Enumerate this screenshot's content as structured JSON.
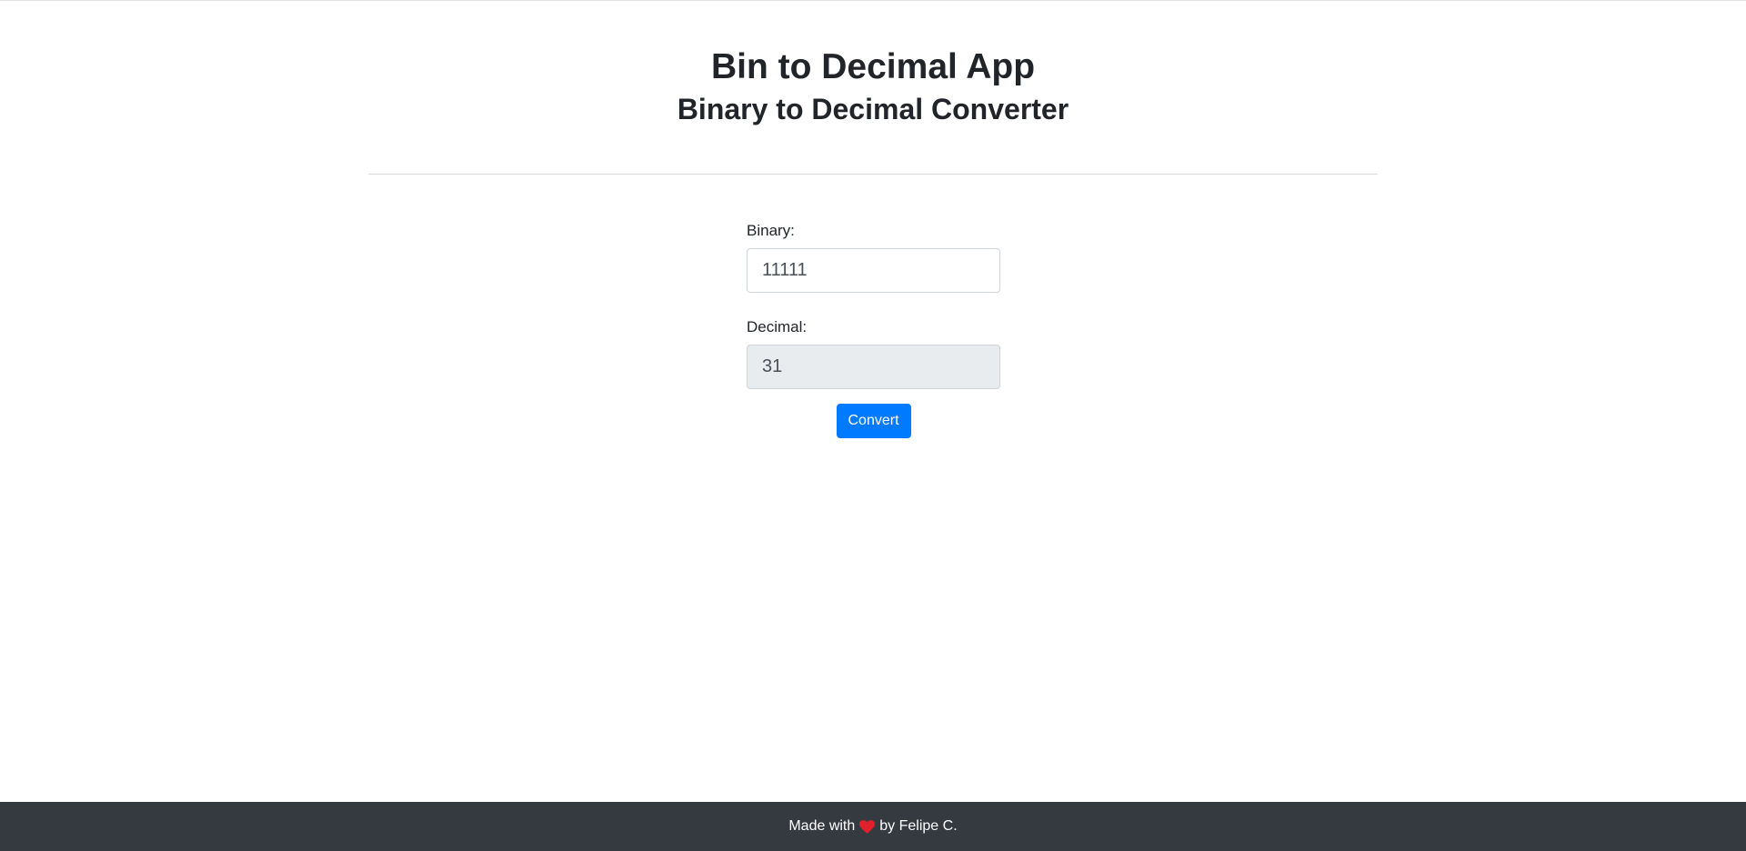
{
  "header": {
    "title": "Bin to Decimal App",
    "subtitle": "Binary to Decimal Converter"
  },
  "form": {
    "binary_label": "Binary:",
    "binary_value": "11111",
    "decimal_label": "Decimal:",
    "decimal_value": "31",
    "convert_label": "Convert"
  },
  "footer": {
    "text_before": "Made with",
    "icon": "heart-icon",
    "text_after": "by Felipe C."
  },
  "colors": {
    "primary": "#007bff",
    "footer_bg": "#343a40",
    "heart": "#e0212b",
    "readonly_bg": "#e9ecef"
  }
}
